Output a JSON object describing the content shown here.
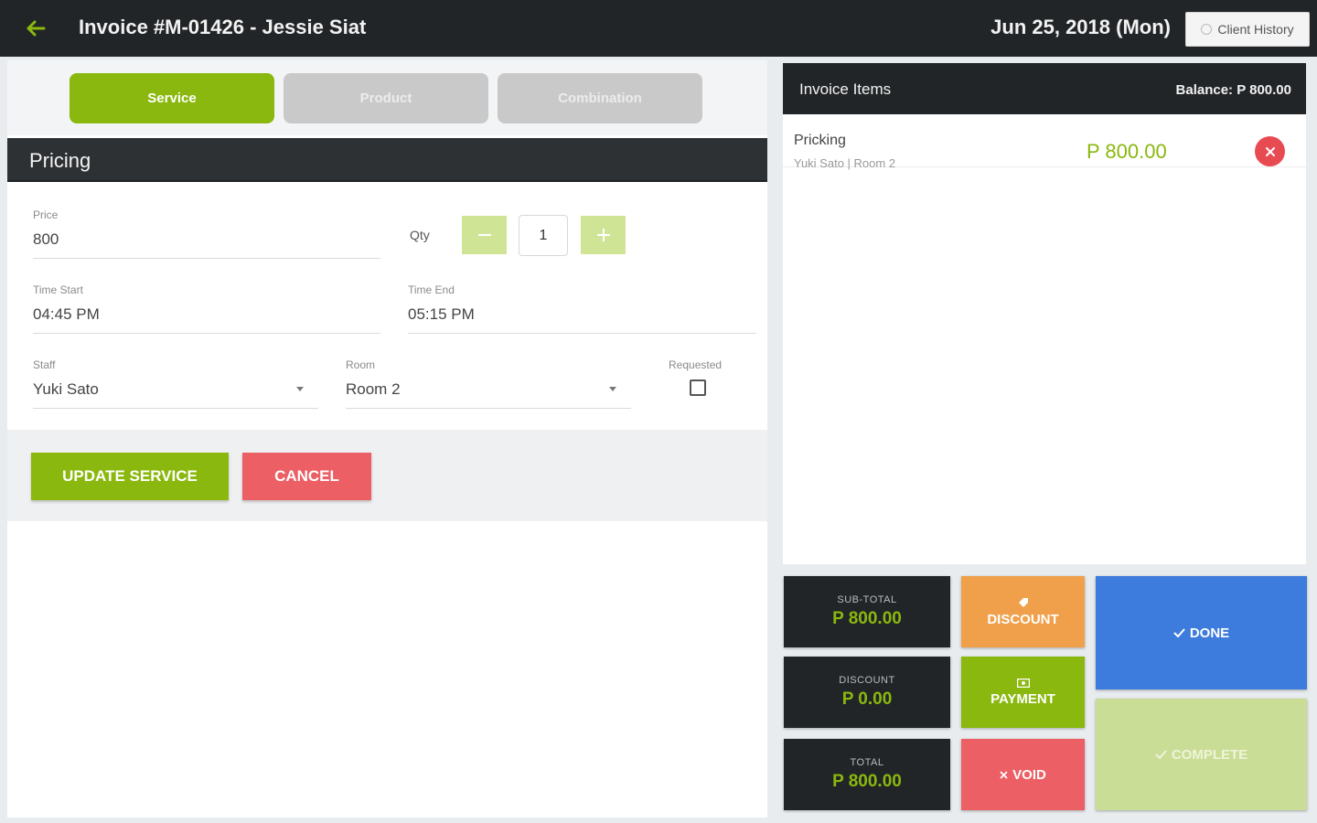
{
  "header": {
    "title": "Invoice #M-01426 - Jessie Siat",
    "date": "Jun 25, 2018 (Mon)",
    "client_history_label": "Client History"
  },
  "tabs": [
    {
      "label": "Service",
      "active": true
    },
    {
      "label": "Product",
      "active": false
    },
    {
      "label": "Combination",
      "active": false
    }
  ],
  "form": {
    "section_title": "Pricing",
    "price": {
      "label": "Price",
      "value": "800"
    },
    "qty": {
      "label": "Qty",
      "value": "1"
    },
    "time_start": {
      "label": "Time Start",
      "value": "04:45 PM"
    },
    "time_end": {
      "label": "Time End",
      "value": "05:15 PM"
    },
    "staff": {
      "label": "Staff",
      "value": "Yuki Sato"
    },
    "room": {
      "label": "Room",
      "value": "Room 2"
    },
    "requested": {
      "label": "Requested",
      "checked": false
    },
    "update_label": "UPDATE SERVICE",
    "cancel_label": "CANCEL"
  },
  "invoice": {
    "title": "Invoice Items",
    "balance": "Balance: P 800.00",
    "items": [
      {
        "name": "Pricking",
        "sub": "Yuki Sato | Room 2",
        "price": "P 800.00"
      }
    ]
  },
  "totals": {
    "subtotal_label": "SUB-TOTAL",
    "subtotal_value": "P 800.00",
    "discount_label": "DISCOUNT",
    "discount_value": "P 0.00",
    "total_label": "TOTAL",
    "total_value": "P 800.00"
  },
  "actions": {
    "discount": "DISCOUNT",
    "payment": "PAYMENT",
    "void": "VOID",
    "done": "DONE",
    "complete": "COMPLETE"
  },
  "colors": {
    "accent_green": "#8ab80e",
    "dark": "#222527",
    "danger": "#ec5f64",
    "orange": "#f0a04a",
    "blue": "#3d7bdc"
  },
  "icons": [
    "back-arrow-icon",
    "clock-icon",
    "minus-icon",
    "plus-icon",
    "chevron-down-icon",
    "close-icon",
    "tag-icon",
    "cash-icon",
    "check-icon"
  ]
}
